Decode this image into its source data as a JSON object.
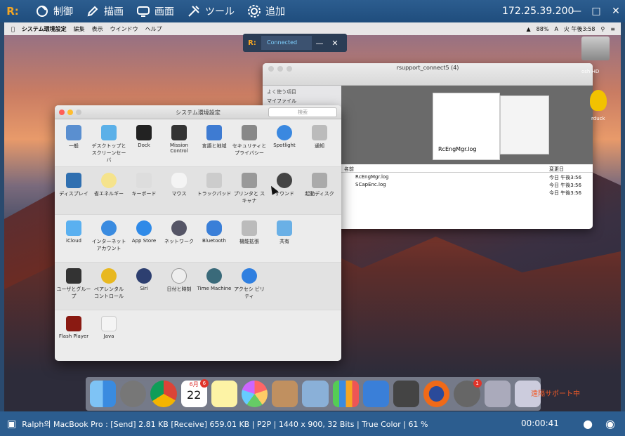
{
  "toolbar": {
    "items": [
      {
        "label": "制御",
        "icon": "control-icon"
      },
      {
        "label": "描画",
        "icon": "pen-icon"
      },
      {
        "label": "画面",
        "icon": "monitor-icon"
      },
      {
        "label": "ツール",
        "icon": "tools-icon"
      },
      {
        "label": "追加",
        "icon": "gear-icon"
      }
    ],
    "ip": "172.25.39.200"
  },
  "mac_menu": {
    "app": "システム環境設定",
    "items": [
      "編集",
      "表示",
      "ウインドウ",
      "ヘルプ"
    ],
    "battery": "88%",
    "clock": "火 午後3:58"
  },
  "remote_bar": {
    "status": "Connected"
  },
  "finder": {
    "title": "rsupport_connect5 (4)",
    "sidebar_header": "よく使う項目",
    "sidebar_item": "マイファイル",
    "preview_caption": "RcEngMgr.log",
    "col_name": "名前",
    "col_date": "変更日",
    "files": [
      {
        "name": "RcEngMgr.log",
        "date": "今日 午後3:56"
      },
      {
        "name": "SCapEnc.log",
        "date": "今日 午後3:56"
      },
      {
        "name": "",
        "date": "今日 午後3:56"
      }
    ]
  },
  "prefs": {
    "title": "システム環境設定",
    "search_placeholder": "検索",
    "rows": [
      [
        "一般",
        "デスクトップと スクリーンセーバ",
        "Dock",
        "Mission Control",
        "言語と地域",
        "セキュリティと プライバシー",
        "Spotlight",
        "通知"
      ],
      [
        "ディスプレイ",
        "省エネルギー",
        "キーボード",
        "マウス",
        "トラックパッド",
        "プリンタと スキャナ",
        "サウンド",
        "起動ディスク"
      ],
      [
        "iCloud",
        "インターネット アカウント",
        "App Store",
        "ネットワーク",
        "Bluetooth",
        "機能拡張",
        "共有"
      ],
      [
        "ユーザとグループ",
        "ペアレンタル コントロール",
        "Siri",
        "日付と時刻",
        "Time Machine",
        "アクセシ ビリティ"
      ],
      [
        "Flash Player",
        "Java"
      ]
    ]
  },
  "desktop": {
    "hd_label": "osh HD",
    "duck_label": "rduck"
  },
  "dock": {
    "calendar_month": "6月",
    "calendar_day": "22",
    "calendar_badge": "6",
    "prefs_badge": "1",
    "rsupport_label": "遠隔サポート中"
  },
  "status": {
    "text": "Ralph의 MacBook Pro : [Send] 2.81 KB  [Receive] 659.01 KB | P2P | 1440 x 900, 32 Bits | True Color | 61 %",
    "time": "00:00:41"
  }
}
